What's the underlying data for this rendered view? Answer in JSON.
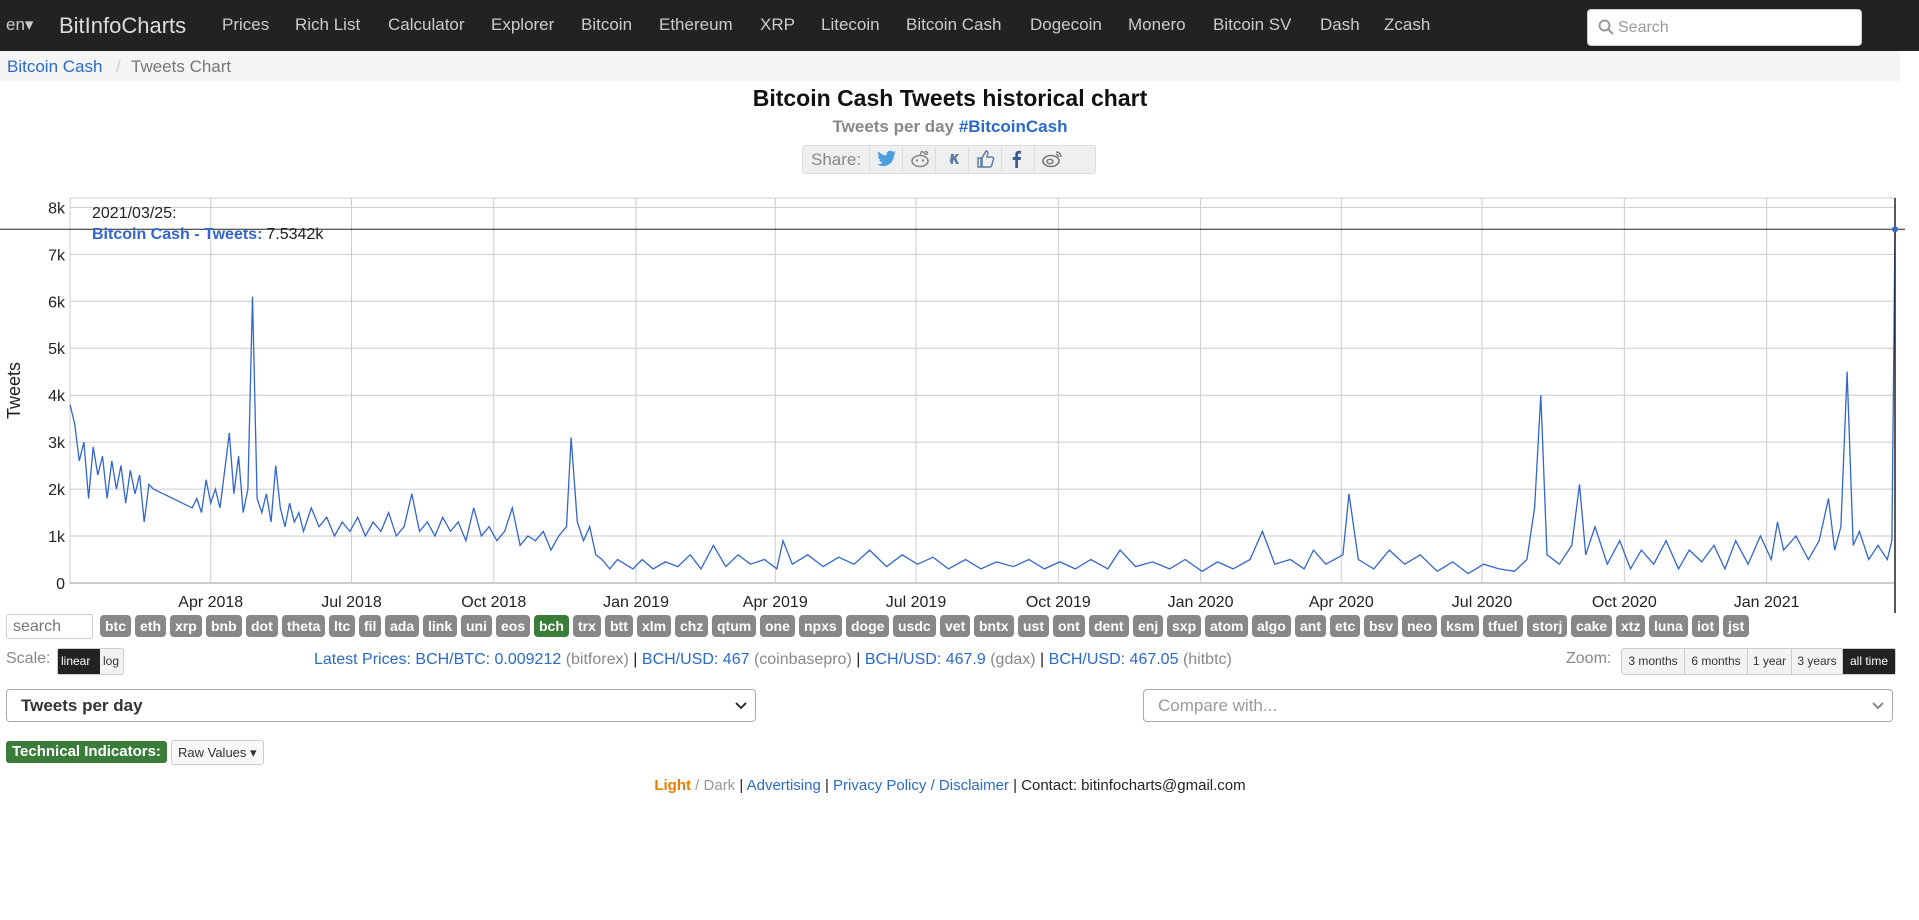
{
  "nav": {
    "lang": "en▾",
    "brand": "BitInfoCharts",
    "items": [
      "Prices",
      "Rich List",
      "Calculator",
      "Explorer",
      "Bitcoin",
      "Ethereum",
      "XRP",
      "Litecoin",
      "Bitcoin Cash",
      "Dogecoin",
      "Monero",
      "Bitcoin SV",
      "Dash",
      "Zcash"
    ],
    "search_placeholder": "Search"
  },
  "breadcrumb": {
    "parent": "Bitcoin Cash",
    "separator": "/",
    "current": "Tweets Chart"
  },
  "header": {
    "title": "Bitcoin Cash Tweets historical chart",
    "subtitle_prefix": "Tweets per day",
    "subtitle_tag": "#BitcoinCash",
    "share_label": "Share:"
  },
  "share_icons": [
    "twitter-icon",
    "reddit-icon",
    "vk-icon",
    "like-icon",
    "facebook-icon",
    "weibo-icon"
  ],
  "chart_data": {
    "type": "line",
    "ylabel": "Tweets",
    "y_ticks": [
      "0",
      "1k",
      "2k",
      "3k",
      "4k",
      "5k",
      "6k",
      "7k",
      "8k"
    ],
    "ylim": [
      0,
      8200
    ],
    "x_ticks": [
      "Apr 2018",
      "Jul 2018",
      "Oct 2018",
      "Jan 2019",
      "Apr 2019",
      "Jul 2019",
      "Oct 2019",
      "Jan 2020",
      "Apr 2020",
      "Jul 2020",
      "Oct 2020",
      "Jan 2021"
    ],
    "x_tick_dates": [
      "2018-04-01",
      "2018-07-01",
      "2018-10-01",
      "2019-01-01",
      "2019-04-01",
      "2019-07-01",
      "2019-10-01",
      "2020-01-01",
      "2020-04-01",
      "2020-07-01",
      "2020-10-01",
      "2021-01-01"
    ],
    "xlim": [
      "2017-12-31",
      "2021-03-25"
    ],
    "grid": true,
    "series": [
      {
        "name": "Bitcoin Cash - Tweets",
        "color": "#3366cc",
        "points": [
          [
            "2017-12-31",
            3800
          ],
          [
            "2018-01-03",
            3400
          ],
          [
            "2018-01-06",
            2600
          ],
          [
            "2018-01-09",
            3000
          ],
          [
            "2018-01-12",
            1800
          ],
          [
            "2018-01-15",
            2900
          ],
          [
            "2018-01-18",
            2300
          ],
          [
            "2018-01-21",
            2700
          ],
          [
            "2018-01-24",
            1800
          ],
          [
            "2018-01-27",
            2600
          ],
          [
            "2018-01-30",
            2000
          ],
          [
            "2018-02-02",
            2500
          ],
          [
            "2018-02-05",
            1700
          ],
          [
            "2018-02-08",
            2400
          ],
          [
            "2018-02-11",
            1900
          ],
          [
            "2018-02-14",
            2300
          ],
          [
            "2018-02-17",
            1300
          ],
          [
            "2018-02-20",
            2100
          ],
          [
            "2018-02-23",
            2000
          ],
          [
            "2018-03-20",
            1600
          ],
          [
            "2018-03-23",
            1800
          ],
          [
            "2018-03-26",
            1500
          ],
          [
            "2018-03-29",
            2200
          ],
          [
            "2018-04-01",
            1700
          ],
          [
            "2018-04-04",
            2000
          ],
          [
            "2018-04-07",
            1600
          ],
          [
            "2018-04-10",
            2400
          ],
          [
            "2018-04-13",
            3200
          ],
          [
            "2018-04-16",
            1900
          ],
          [
            "2018-04-19",
            2700
          ],
          [
            "2018-04-22",
            1500
          ],
          [
            "2018-04-25",
            2000
          ],
          [
            "2018-04-28",
            6100
          ],
          [
            "2018-05-01",
            1800
          ],
          [
            "2018-05-04",
            1500
          ],
          [
            "2018-05-07",
            1900
          ],
          [
            "2018-05-10",
            1300
          ],
          [
            "2018-05-13",
            2500
          ],
          [
            "2018-05-16",
            1600
          ],
          [
            "2018-05-19",
            1200
          ],
          [
            "2018-05-22",
            1700
          ],
          [
            "2018-05-25",
            1300
          ],
          [
            "2018-05-28",
            1500
          ],
          [
            "2018-05-31",
            1100
          ],
          [
            "2018-06-05",
            1600
          ],
          [
            "2018-06-10",
            1200
          ],
          [
            "2018-06-15",
            1400
          ],
          [
            "2018-06-20",
            1000
          ],
          [
            "2018-06-25",
            1300
          ],
          [
            "2018-06-30",
            1100
          ],
          [
            "2018-07-05",
            1400
          ],
          [
            "2018-07-10",
            1000
          ],
          [
            "2018-07-15",
            1300
          ],
          [
            "2018-07-20",
            1100
          ],
          [
            "2018-07-25",
            1500
          ],
          [
            "2018-07-30",
            1000
          ],
          [
            "2018-08-04",
            1200
          ],
          [
            "2018-08-09",
            1900
          ],
          [
            "2018-08-14",
            1100
          ],
          [
            "2018-08-19",
            1300
          ],
          [
            "2018-08-24",
            1000
          ],
          [
            "2018-08-29",
            1400
          ],
          [
            "2018-09-03",
            1100
          ],
          [
            "2018-09-08",
            1300
          ],
          [
            "2018-09-13",
            900
          ],
          [
            "2018-09-18",
            1600
          ],
          [
            "2018-09-23",
            1000
          ],
          [
            "2018-09-28",
            1200
          ],
          [
            "2018-10-03",
            900
          ],
          [
            "2018-10-08",
            1100
          ],
          [
            "2018-10-13",
            1600
          ],
          [
            "2018-10-18",
            800
          ],
          [
            "2018-10-23",
            1000
          ],
          [
            "2018-10-28",
            900
          ],
          [
            "2018-11-02",
            1100
          ],
          [
            "2018-11-07",
            700
          ],
          [
            "2018-11-12",
            1000
          ],
          [
            "2018-11-17",
            1200
          ],
          [
            "2018-11-20",
            3100
          ],
          [
            "2018-11-24",
            1300
          ],
          [
            "2018-11-28",
            900
          ],
          [
            "2018-12-02",
            1200
          ],
          [
            "2018-12-06",
            600
          ],
          [
            "2018-12-10",
            500
          ],
          [
            "2018-12-15",
            300
          ],
          [
            "2018-12-20",
            500
          ],
          [
            "2018-12-25",
            400
          ],
          [
            "2018-12-30",
            300
          ],
          [
            "2019-01-05",
            500
          ],
          [
            "2019-01-12",
            300
          ],
          [
            "2019-01-20",
            450
          ],
          [
            "2019-01-28",
            350
          ],
          [
            "2019-02-05",
            600
          ],
          [
            "2019-02-12",
            300
          ],
          [
            "2019-02-20",
            800
          ],
          [
            "2019-02-28",
            350
          ],
          [
            "2019-03-08",
            600
          ],
          [
            "2019-03-16",
            400
          ],
          [
            "2019-03-25",
            500
          ],
          [
            "2019-04-02",
            300
          ],
          [
            "2019-04-06",
            900
          ],
          [
            "2019-04-12",
            400
          ],
          [
            "2019-04-22",
            600
          ],
          [
            "2019-05-02",
            350
          ],
          [
            "2019-05-12",
            550
          ],
          [
            "2019-05-22",
            400
          ],
          [
            "2019-06-01",
            700
          ],
          [
            "2019-06-12",
            350
          ],
          [
            "2019-06-22",
            600
          ],
          [
            "2019-07-02",
            400
          ],
          [
            "2019-07-12",
            550
          ],
          [
            "2019-07-22",
            300
          ],
          [
            "2019-08-02",
            500
          ],
          [
            "2019-08-12",
            300
          ],
          [
            "2019-08-22",
            450
          ],
          [
            "2019-09-02",
            350
          ],
          [
            "2019-09-12",
            500
          ],
          [
            "2019-09-22",
            300
          ],
          [
            "2019-10-02",
            450
          ],
          [
            "2019-10-12",
            300
          ],
          [
            "2019-10-22",
            500
          ],
          [
            "2019-11-02",
            300
          ],
          [
            "2019-11-10",
            700
          ],
          [
            "2019-11-20",
            350
          ],
          [
            "2019-12-01",
            450
          ],
          [
            "2019-12-12",
            300
          ],
          [
            "2019-12-22",
            500
          ],
          [
            "2020-01-02",
            250
          ],
          [
            "2020-01-12",
            450
          ],
          [
            "2020-01-22",
            300
          ],
          [
            "2020-02-02",
            500
          ],
          [
            "2020-02-10",
            1100
          ],
          [
            "2020-02-18",
            400
          ],
          [
            "2020-02-28",
            500
          ],
          [
            "2020-03-08",
            300
          ],
          [
            "2020-03-14",
            700
          ],
          [
            "2020-03-22",
            400
          ],
          [
            "2020-04-02",
            600
          ],
          [
            "2020-04-06",
            1900
          ],
          [
            "2020-04-12",
            500
          ],
          [
            "2020-04-22",
            300
          ],
          [
            "2020-05-02",
            700
          ],
          [
            "2020-05-12",
            400
          ],
          [
            "2020-05-22",
            600
          ],
          [
            "2020-06-02",
            250
          ],
          [
            "2020-06-12",
            450
          ],
          [
            "2020-06-22",
            200
          ],
          [
            "2020-07-02",
            400
          ],
          [
            "2020-07-12",
            300
          ],
          [
            "2020-07-22",
            250
          ],
          [
            "2020-07-30",
            500
          ],
          [
            "2020-08-04",
            1600
          ],
          [
            "2020-08-08",
            4000
          ],
          [
            "2020-08-12",
            600
          ],
          [
            "2020-08-20",
            400
          ],
          [
            "2020-08-28",
            800
          ],
          [
            "2020-09-02",
            2100
          ],
          [
            "2020-09-06",
            600
          ],
          [
            "2020-09-12",
            1200
          ],
          [
            "2020-09-20",
            400
          ],
          [
            "2020-09-28",
            900
          ],
          [
            "2020-10-05",
            300
          ],
          [
            "2020-10-12",
            700
          ],
          [
            "2020-10-20",
            400
          ],
          [
            "2020-10-28",
            900
          ],
          [
            "2020-11-05",
            300
          ],
          [
            "2020-11-12",
            700
          ],
          [
            "2020-11-20",
            450
          ],
          [
            "2020-11-28",
            800
          ],
          [
            "2020-12-05",
            300
          ],
          [
            "2020-12-12",
            900
          ],
          [
            "2020-12-20",
            400
          ],
          [
            "2020-12-28",
            1000
          ],
          [
            "2021-01-04",
            500
          ],
          [
            "2021-01-08",
            1300
          ],
          [
            "2021-01-12",
            700
          ],
          [
            "2021-01-20",
            1000
          ],
          [
            "2021-01-28",
            500
          ],
          [
            "2021-02-04",
            900
          ],
          [
            "2021-02-10",
            1800
          ],
          [
            "2021-02-14",
            700
          ],
          [
            "2021-02-18",
            1200
          ],
          [
            "2021-02-22",
            4500
          ],
          [
            "2021-02-26",
            800
          ],
          [
            "2021-03-02",
            1100
          ],
          [
            "2021-03-08",
            500
          ],
          [
            "2021-03-14",
            800
          ],
          [
            "2021-03-20",
            500
          ],
          [
            "2021-03-23",
            900
          ],
          [
            "2021-03-25",
            7534
          ]
        ]
      }
    ],
    "crosshair_value": 7534
  },
  "tooltip": {
    "date": "2021/03/25:",
    "series_label": "Bitcoin Cash - Tweets:",
    "value": "7.5342k"
  },
  "coins": {
    "search_placeholder": "search",
    "items": [
      "btc",
      "eth",
      "xrp",
      "bnb",
      "dot",
      "theta",
      "ltc",
      "fil",
      "ada",
      "link",
      "uni",
      "eos",
      "bch",
      "trx",
      "btt",
      "xlm",
      "chz",
      "qtum",
      "one",
      "npxs",
      "doge",
      "usdc",
      "vet",
      "bntx",
      "ust",
      "ont",
      "dent",
      "enj",
      "sxp",
      "atom",
      "algo",
      "ant",
      "etc",
      "bsv",
      "neo",
      "ksm",
      "tfuel",
      "storj",
      "cake",
      "xtz",
      "luna",
      "iot",
      "jst"
    ],
    "active": "bch"
  },
  "scale": {
    "label": "Scale:",
    "options": [
      "linear",
      "log"
    ],
    "active": "linear"
  },
  "prices": {
    "prefix": "Latest Prices:",
    "quotes": [
      {
        "pair": "BCH/BTC: 0.009212",
        "exchange": "(bitforex)"
      },
      {
        "pair": "BCH/USD: 467",
        "exchange": "(coinbasepro)"
      },
      {
        "pair": "BCH/USD: 467.9",
        "exchange": "(gdax)"
      },
      {
        "pair": "BCH/USD: 467.05",
        "exchange": "(hitbtc)"
      }
    ]
  },
  "zoom": {
    "label": "Zoom:",
    "options": [
      "3 months",
      "6 months",
      "1 year",
      "3 years",
      "all time"
    ],
    "active": "all time"
  },
  "selects": {
    "metric": "Tweets per day",
    "compare_placeholder": "Compare with..."
  },
  "indicators": {
    "label": "Technical Indicators:",
    "value": "Raw Values"
  },
  "footer": {
    "light": "Light",
    "slash": " / ",
    "dark": "Dark",
    "advertising": "Advertising",
    "privacy": "Privacy Policy",
    "disclaimer": "Disclaimer",
    "contact": "Contact: bitinfocharts@gmail.com"
  },
  "colors": {
    "navbar": "#222222",
    "link": "#2a6ac8",
    "series": "#3366cc",
    "active_coin": "#3a7d3a",
    "light_theme": "#e67e00"
  }
}
